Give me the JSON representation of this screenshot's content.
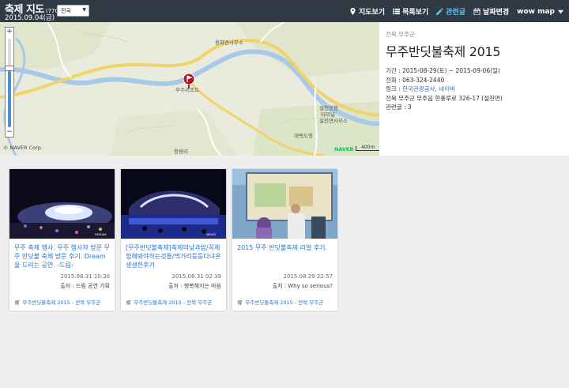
{
  "header": {
    "title": "축제 지도",
    "count": "(770)",
    "date": "2015.09.04(금)",
    "region_select": "전국",
    "nav": [
      {
        "label": "지도보기",
        "icon": "map-pin-icon"
      },
      {
        "label": "목록보기",
        "icon": "list-icon"
      },
      {
        "label": "관련글",
        "icon": "pencil-icon",
        "active": true
      },
      {
        "label": "날짜변경",
        "icon": "calendar-icon"
      },
      {
        "label": "wow map",
        "icon": "caret-down-icon"
      }
    ],
    "accent": "#5bc0f0",
    "bar_color": "#2f3a45"
  },
  "map": {
    "labels": {
      "town_office": "용화면사무소",
      "marker_label": "무주리조트",
      "terminal_1": "설천공용",
      "terminal_2": "터미널",
      "seolcheon_office": "설천면사무소",
      "taebaek": "태백도령",
      "cheongnyangri": "청량리"
    },
    "copyright": "© NAVER Corp.",
    "logo": "NAVER",
    "scale": "400m",
    "zoom_level": 0.66
  },
  "info": {
    "region": "전북 무주군",
    "title": "무주반딧불축제 2015",
    "period_label": "기간 : ",
    "period": "2015-08-29(토) ~ 2015-09-06(일)",
    "phone_label": "전화 : ",
    "phone": "063-324-2440",
    "link_label": "링크 : ",
    "link_1": "한국관광공사",
    "link_sep": ", ",
    "link_2": "네이버",
    "address": "전북 무주군 무주읍 한풍루로 326-17 (설천면)",
    "related_label": "관련글 : ",
    "related": "3"
  },
  "cards": [
    {
      "title": "무주 축제 행사. 무주 행사차 방문 무주 반딧불 축제 방문 후기. Dream을 드리는 공연. -드림-",
      "date": "2015.08.31 10:30",
      "source": "출처 : 드림 공연 기획",
      "festival": "무주반딧불축제 2015 - 전북 무주군"
    },
    {
      "title": "[무주반딧불축제]축제의낮과밤/꼭체험해봐야하는것들/먹거리등등다녀온생생한후기",
      "date": "2015.08.31 02:39",
      "source": "출처 : 행복해지는 마음",
      "festival": "무주반딧불축제 2015 - 전북 무주군"
    },
    {
      "title": "2015 무주 반딧불축제 리얼 후기.",
      "date": "2015.08.29 22:57",
      "source": "출처 : Why so serious?",
      "festival": "무주반딧불축제 2015 - 전북 무주군"
    }
  ]
}
